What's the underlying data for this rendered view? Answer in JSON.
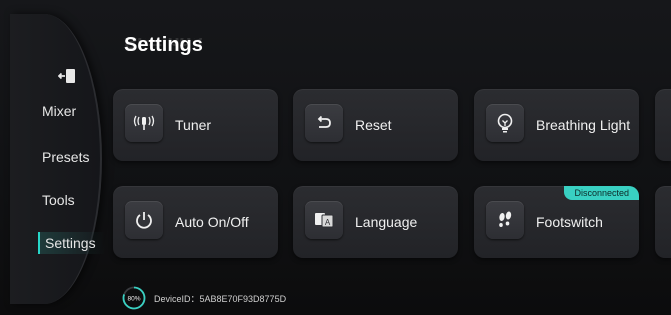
{
  "header": {
    "title": "Settings"
  },
  "sidebar": {
    "items": [
      {
        "label": "Mixer"
      },
      {
        "label": "Presets"
      },
      {
        "label": "Tools"
      },
      {
        "label": "Settings",
        "active": true
      }
    ],
    "exit_icon": "exit-door-icon",
    "accent": "#27d6c8"
  },
  "cards": [
    {
      "label": "Tuner",
      "icon": "tuner-signal-icon"
    },
    {
      "label": "Reset",
      "icon": "undo-arrow-icon"
    },
    {
      "label": "Breathing Light",
      "icon": "lightbulb-icon"
    },
    {
      "label": "Auto On/Off",
      "icon": "power-icon"
    },
    {
      "label": "Language",
      "icon": "translate-icon"
    },
    {
      "label": "Footswitch",
      "icon": "footprints-icon",
      "badge": "Disconnected"
    }
  ],
  "footer": {
    "battery": "80%",
    "battery_level": 0.8,
    "device_id": "DeviceID：5AB8E70F93D8775D"
  },
  "colors": {
    "badge": "#39d0c2",
    "card": "#2b2c30"
  }
}
